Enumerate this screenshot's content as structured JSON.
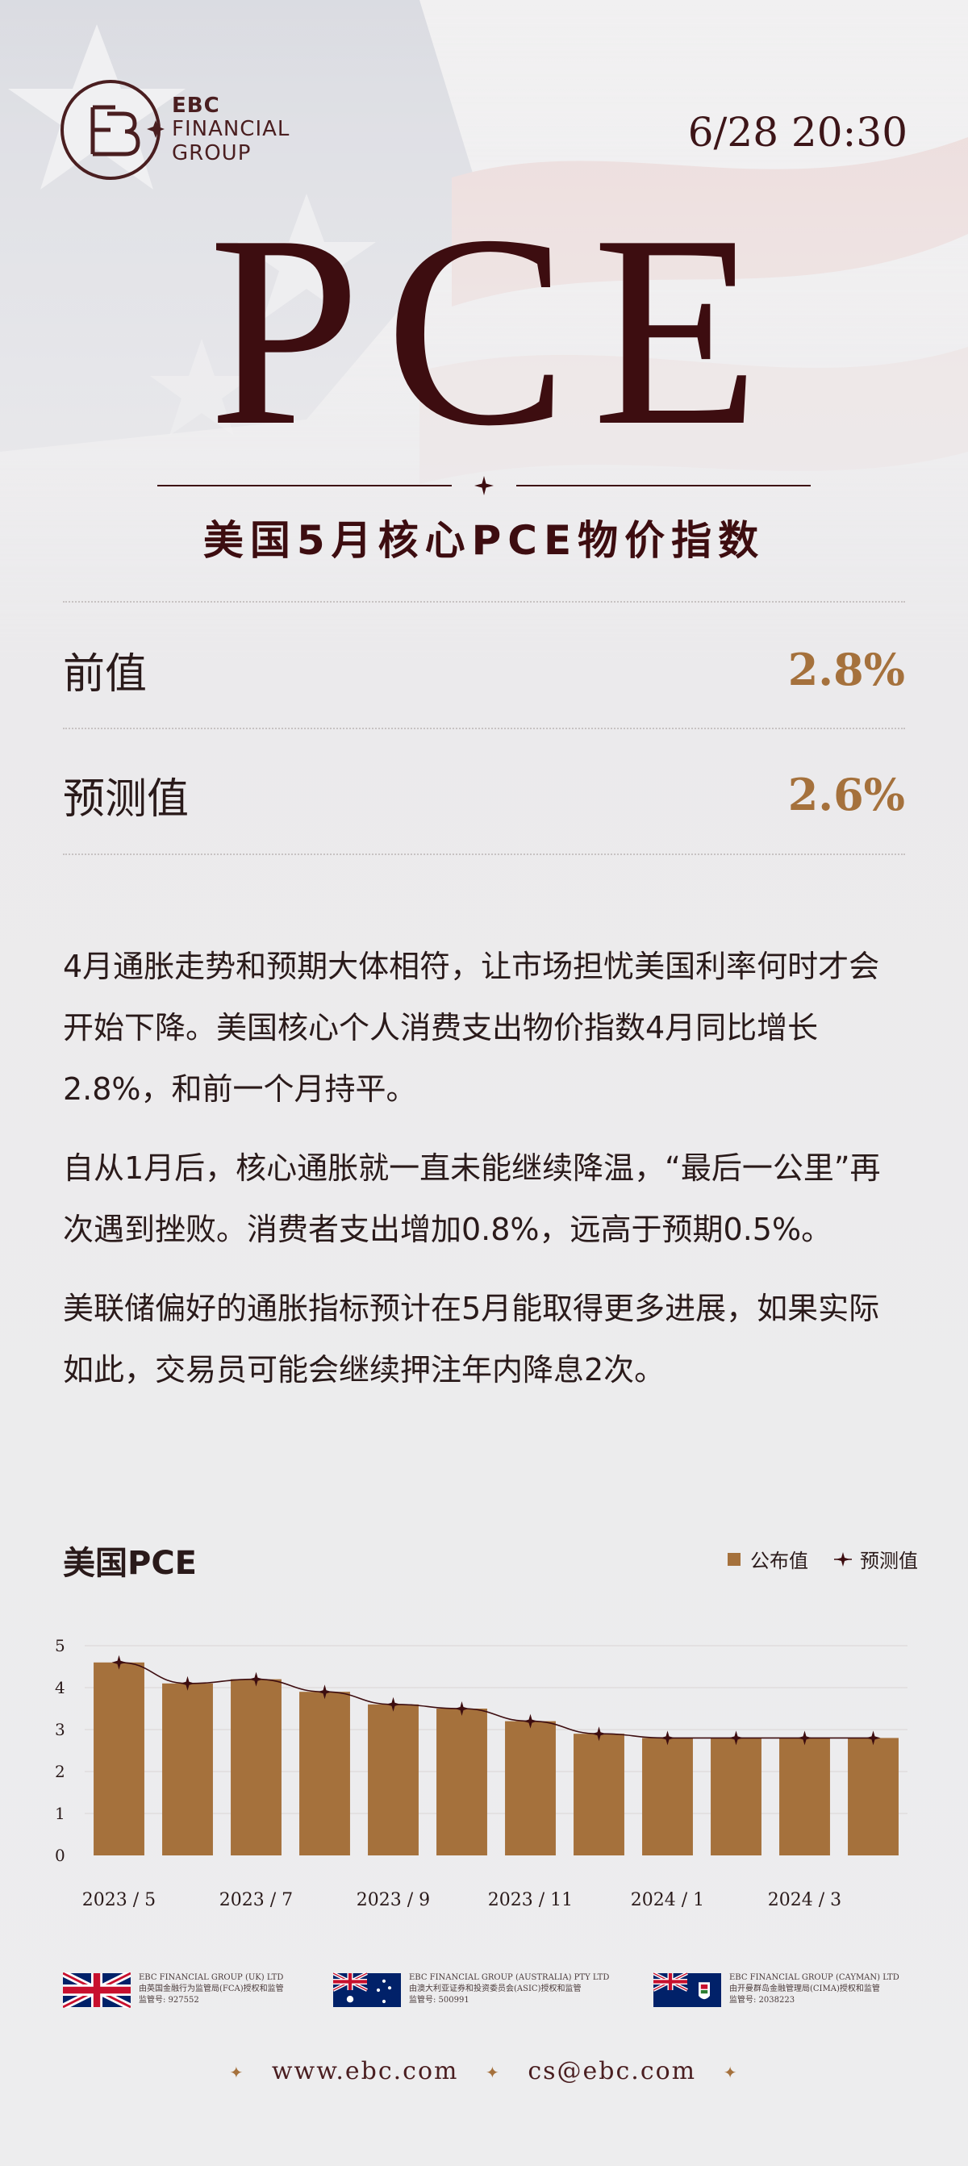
{
  "header": {
    "logo_line1": "EBC",
    "logo_line2": "FINANCIAL",
    "logo_line3": "GROUP",
    "datetime": "6/28 20:30"
  },
  "title": "PCE",
  "subtitle": "美国5月核心PCE物价指数",
  "stats": [
    {
      "label": "前值",
      "value": "2.8%"
    },
    {
      "label": "预测值",
      "value": "2.6%"
    }
  ],
  "paragraphs": [
    "4月通胀走势和预期大体相符，让市场担忧美国利率何时才会开始下降。美国核心个人消费支出物价指数4月同比增长2.8%，和前一个月持平。",
    "自从1月后，核心通胀就一直未能继续降温，“最后一公里”再次遇到挫败。消费者支出增加0.8%，远高于预期0.5%。",
    "美联储偏好的通胀指标预计在5月能取得更多进展，如果实际如此，交易员可能会继续押注年内降息2次。"
  ],
  "chart_title": "美国PCE",
  "legend": {
    "published": "公布值",
    "forecast": "预测值"
  },
  "colors": {
    "bar": "#a5713c",
    "forecast": "#3d0d10",
    "title": "#3d0d10",
    "accent": "#a5713c"
  },
  "chart_data": {
    "type": "bar",
    "title": "美国PCE",
    "categories": [
      "2023/5",
      "2023/6",
      "2023/7",
      "2023/8",
      "2023/9",
      "2023/10",
      "2023/11",
      "2023/12",
      "2024/1",
      "2024/2",
      "2024/3",
      "2024/4"
    ],
    "x_tick_labels": [
      "2023 / 5",
      "2023 / 7",
      "2023 / 9",
      "2023 / 11",
      "2024 / 1",
      "2024 / 3"
    ],
    "y_ticks": [
      0,
      1,
      2,
      3,
      4,
      5
    ],
    "ylim": [
      0,
      5
    ],
    "grid": true,
    "legend_position": "top-right",
    "series": [
      {
        "name": "公布值",
        "type": "bar",
        "values": [
          4.6,
          4.1,
          4.2,
          3.9,
          3.6,
          3.5,
          3.2,
          2.9,
          2.8,
          2.8,
          2.8,
          2.8
        ]
      },
      {
        "name": "预测值",
        "type": "line",
        "values": [
          4.6,
          4.1,
          4.2,
          3.9,
          3.6,
          3.5,
          3.2,
          2.9,
          2.8,
          2.8,
          2.8,
          2.8
        ]
      }
    ]
  },
  "regulators": [
    {
      "flag": "uk-flag-icon",
      "name": "EBC FINANCIAL GROUP (UK) LTD",
      "desc": "由英国金融行为监管局(FCA)授权和监管",
      "reg_no": "监管号: 927552"
    },
    {
      "flag": "australia-flag-icon",
      "name": "EBC FINANCIAL GROUP (AUSTRALIA) PTY LTD",
      "desc": "由澳大利亚证券和投资委员会(ASIC)授权和监管",
      "reg_no": "监管号: 500991"
    },
    {
      "flag": "cayman-flag-icon",
      "name": "EBC FINANCIAL GROUP (CAYMAN) LTD",
      "desc": "由开曼群岛金融管理局(CIMA)授权和监管",
      "reg_no": "监管号: 2038223"
    }
  ],
  "contact": {
    "website": "www.ebc.com",
    "email": "cs@ebc.com"
  }
}
